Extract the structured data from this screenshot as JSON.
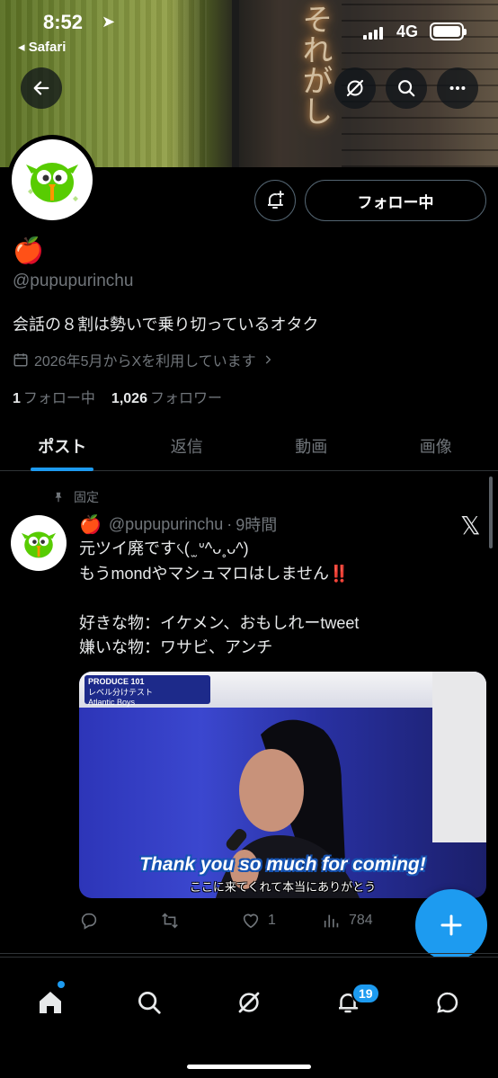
{
  "status_bar": {
    "time": "8:52",
    "location_glyph": "➤",
    "back_app": "◂ Safari",
    "network": "4G"
  },
  "profile": {
    "name_emoji": "🍎",
    "handle": "@pupupurinchu",
    "bio": "会話の８割は勢いで乗り切っているオタク",
    "joined": "2026年5月からXを利用しています",
    "following_count": "1",
    "following_label": "フォロー中",
    "followers_count": "1,026",
    "followers_label": "フォロワー",
    "follow_button": "フォロー中"
  },
  "tabs": [
    {
      "label": "ポスト",
      "active": true
    },
    {
      "label": "返信",
      "active": false
    },
    {
      "label": "動画",
      "active": false
    },
    {
      "label": "画像",
      "active": false
    }
  ],
  "post": {
    "pinned_label": "固定",
    "author_emoji": "🍎",
    "author_handle": "@pupupurinchu",
    "separator": "·",
    "time_ago": "9時間",
    "text": "元ツイ廃です৻( ̫ ᐡ^ᴗ˳ᴗ^)\nもうmondやマシュマロはしません‼️\n\n好きな物：イケメン、おもしれーtweet\n嫌いな物：ワサビ、アンチ",
    "media": {
      "subtitle_en": "Thank you so much for coming!",
      "subtitle_ja": "ここに来てくれて本当にありがとう",
      "badge_title": "PRODUCE 101",
      "badge_team": "Atlantic Boys",
      "badge_test": "レベル分けテスト"
    },
    "replies": "",
    "reposts": "",
    "likes": "1",
    "views": "784"
  },
  "nav": {
    "notifications_badge": "19"
  },
  "colors": {
    "accent": "#1d9bf0",
    "background": "#000000",
    "muted": "#71767b"
  }
}
